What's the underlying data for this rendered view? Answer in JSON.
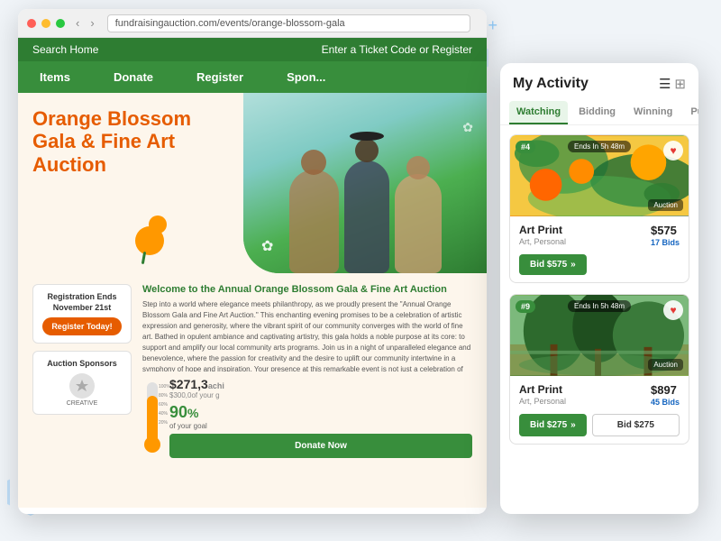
{
  "browser": {
    "url": "fundraisingauction.com/events/orange-blossom-gala"
  },
  "site": {
    "search_bar": {
      "left_label": "Search Home",
      "right_label": "Enter a Ticket Code or Register"
    },
    "nav": {
      "items": [
        {
          "label": "Items"
        },
        {
          "label": "Donate"
        },
        {
          "label": "Register"
        },
        {
          "label": "Spon..."
        }
      ]
    }
  },
  "hero": {
    "title": "Orange Blossom Gala & Fine Art Auction"
  },
  "sidebar": {
    "reg_title": "Registration Ends November 21st",
    "reg_btn": "Register Today!",
    "sponsors_title": "Auction Sponsors",
    "sponsor_name": "CREATIVE"
  },
  "main": {
    "welcome_title": "Welcome to the Annual Orange Blossom Gala & Fine Art Auction",
    "welcome_text": "Step into a world where elegance meets philanthropy, as we proudly present the \"Annual Orange Blossom Gala and Fine Art Auction.\" This enchanting evening promises to be a celebration of artistic expression and generosity, where the vibrant spirit of our community converges with the world of fine art. Bathed in opulent ambiance and captivating artistry, this gala holds a noble purpose at its core: to support and amplify our local community arts programs. Join us in a night of unparalleled elegance and benevolence, where the passion for creativity and the desire to uplift our community intertwine in a symphony of hope and inspiration. Your presence at this remarkable event is not just a celebration of art; it is a testament to your commitment to nurturing the cultural heart of our community. Welcome to the Annual Orange Blossom Gala and Fine Art Auction, where every bid is a brushstroke in the canvas of a brighter future for our community's artistic aspirations.",
    "donate": {
      "amount": "$271,3",
      "amount_suffix": "achi",
      "goal": "$300,0",
      "goal_suffix": "of your g",
      "pct": "90",
      "pct_label": "of your goal",
      "donate_btn": "Donate Now"
    }
  },
  "activity_panel": {
    "title": "My Activity",
    "tabs": [
      {
        "label": "Watching",
        "active": true
      },
      {
        "label": "Bidding",
        "active": false
      },
      {
        "label": "Winning",
        "active": false
      },
      {
        "label": "Purchases",
        "active": false
      }
    ],
    "cards": [
      {
        "badge": "#4",
        "timer": "Ends In 5h 48m",
        "name": "Art Print",
        "category": "Art, Personal",
        "price": "$575",
        "bids": "17 Bids",
        "bid_btn": "Bid $575",
        "type": "Auction"
      },
      {
        "badge": "#9",
        "timer": "Ends In 5h 48m",
        "name": "Art Print",
        "category": "Art, Personal",
        "price": "$897",
        "bids": "45 Bids",
        "bid_btn": "Bid $275",
        "bid_input_val": "Bid $275",
        "type": "Auction"
      }
    ]
  },
  "decorations": {
    "plus1": "+",
    "plus2": "+"
  }
}
